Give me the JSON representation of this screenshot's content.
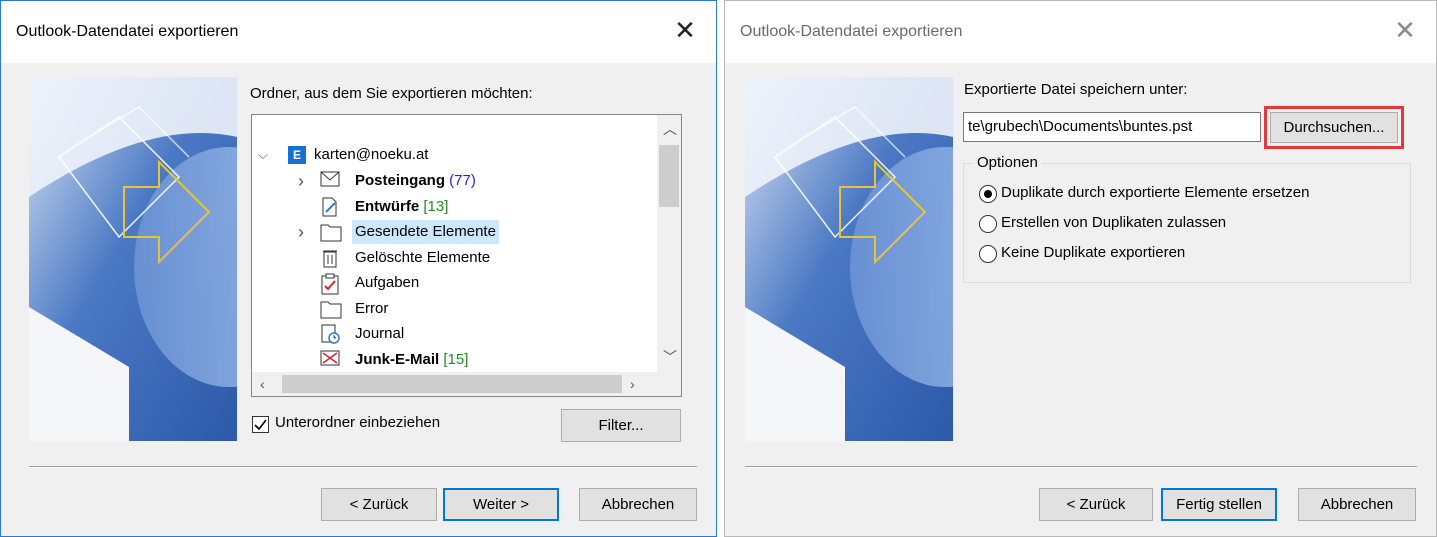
{
  "dialog1": {
    "title": "Outlook-Datendatei exportieren",
    "folder_prompt": "Ordner, aus dem Sie exportieren möchten:",
    "tree": {
      "account": "karten@noeku.at",
      "items": [
        {
          "label": "Posteingang",
          "count": "(77)",
          "count_color": "blue",
          "bold": true,
          "icon": "envelope-icon",
          "expandable": true
        },
        {
          "label": "Entwürfe",
          "count": "[13]",
          "count_color": "green",
          "bold": true,
          "icon": "draft-icon",
          "expandable": false
        },
        {
          "label": "Gesendete Elemente",
          "count": "",
          "bold": false,
          "icon": "folder-icon",
          "expandable": true,
          "selected": true
        },
        {
          "label": "Gelöschte Elemente",
          "count": "",
          "bold": false,
          "icon": "trash-icon",
          "expandable": false
        },
        {
          "label": "Aufgaben",
          "count": "",
          "bold": false,
          "icon": "task-icon",
          "expandable": false
        },
        {
          "label": "Error",
          "count": "",
          "bold": false,
          "icon": "folder-icon",
          "expandable": false
        },
        {
          "label": "Journal",
          "count": "",
          "bold": false,
          "icon": "journal-icon",
          "expandable": false
        },
        {
          "label": "Junk-E-Mail",
          "count": "[15]",
          "count_color": "green",
          "bold": true,
          "icon": "junk-icon",
          "expandable": false
        }
      ]
    },
    "include_subfolders": "Unterordner einbeziehen",
    "filter_button": "Filter...",
    "back_button": "< Zurück",
    "next_button": "Weiter >",
    "cancel_button": "Abbrechen"
  },
  "dialog2": {
    "title": "Outlook-Datendatei exportieren",
    "save_label": "Exportierte Datei speichern unter:",
    "file_path": "te\\grubech\\Documents\\buntes.pst",
    "browse_button": "Durchsuchen...",
    "options_legend": "Optionen",
    "options": [
      {
        "label": "Duplikate durch exportierte Elemente ersetzen",
        "selected": true
      },
      {
        "label": "Erstellen von Duplikaten zulassen",
        "selected": false
      },
      {
        "label": "Keine Duplikate exportieren",
        "selected": false
      }
    ],
    "back_button": "< Zurück",
    "finish_button": "Fertig stellen",
    "cancel_button": "Abbrechen"
  },
  "colors": {
    "accent": "#0078d7",
    "highlight": "#e13a3a",
    "selected_row": "#cce8ff"
  }
}
